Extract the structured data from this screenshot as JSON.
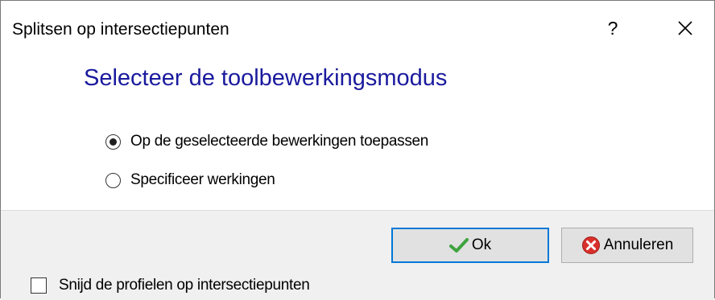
{
  "window": {
    "title": "Splitsen op intersectiepunten",
    "help_label": "?",
    "close_label": "✕"
  },
  "heading": "Selecteer de toolbewerkingsmodus",
  "options": [
    {
      "label": "Op de geselecteerde bewerkingen toepassen",
      "selected": true
    },
    {
      "label": "Specificeer werkingen",
      "selected": false
    }
  ],
  "buttons": {
    "ok_label": "Ok",
    "ok_icon": "checkmark-icon",
    "cancel_label": "Annuleren",
    "cancel_icon": "cancel-icon"
  },
  "checkbox": {
    "label": "Snijd de profielen op intersectiepunten",
    "checked": false
  },
  "colors": {
    "heading": "#1a1a9e",
    "ok_border": "#0078d7",
    "footer_bg": "#f0f0f0"
  }
}
